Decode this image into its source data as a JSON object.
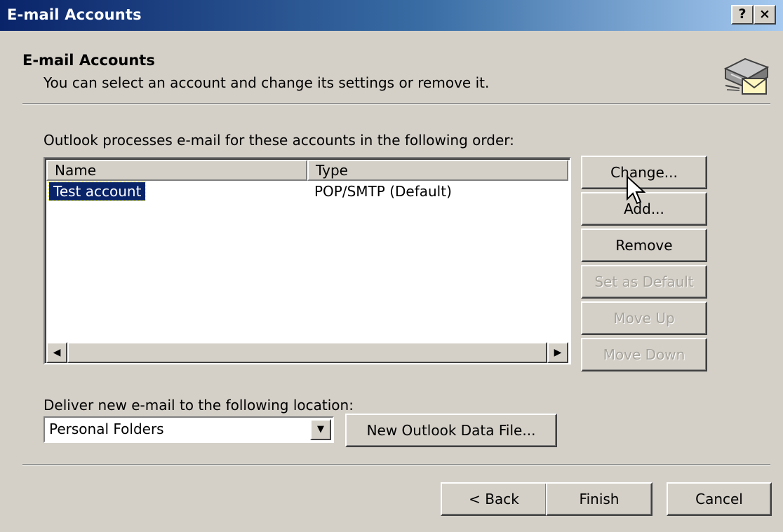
{
  "window": {
    "title": "E-mail Accounts",
    "help_label": "?",
    "close_label": "×"
  },
  "header": {
    "title": "E-mail Accounts",
    "subtitle": "You can select an account and change its settings or remove it.",
    "icon": "email-accounts-icon"
  },
  "accounts": {
    "label": "Outlook processes e-mail for these accounts in the following order:",
    "columns": [
      "Name",
      "Type"
    ],
    "rows": [
      {
        "name": "Test account",
        "type": "POP/SMTP (Default)",
        "selected": true
      }
    ]
  },
  "side_buttons": {
    "change": "Change...",
    "add": "Add...",
    "remove": "Remove",
    "set_default": "Set as Default",
    "move_up": "Move Up",
    "move_down": "Move Down"
  },
  "delivery": {
    "label": "Deliver new e-mail to the following location:",
    "location": "Personal Folders",
    "new_data_file": "New Outlook Data File..."
  },
  "footer": {
    "back": "< Back",
    "finish": "Finish",
    "cancel": "Cancel"
  },
  "colors": {
    "titlebar_start": "#0a246a",
    "titlebar_end": "#a6caf0",
    "dialog_bg": "#d4d0c8",
    "selection": "#0a246a"
  }
}
